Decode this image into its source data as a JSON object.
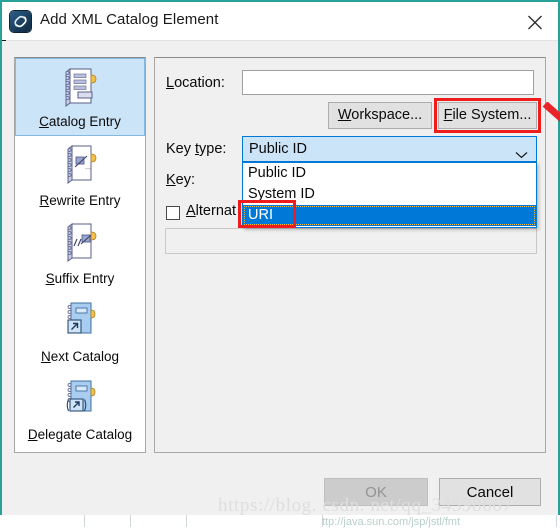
{
  "window": {
    "title": "Add XML Catalog Element",
    "icon": "xml-catalog-icon",
    "close_icon": "close-icon",
    "frame_color": "#2aa198"
  },
  "sidebar": {
    "items": [
      {
        "label": "Catalog Entry",
        "mnemonic": "C",
        "icon": "catalog-entry-icon",
        "selected": true
      },
      {
        "label": "Rewrite Entry",
        "mnemonic": "R",
        "icon": "rewrite-entry-icon",
        "selected": false
      },
      {
        "label": "Suffix Entry",
        "mnemonic": "S",
        "icon": "suffix-entry-icon",
        "selected": false
      },
      {
        "label": "Next Catalog",
        "mnemonic": "N",
        "icon": "next-catalog-icon",
        "selected": false
      },
      {
        "label": "Delegate Catalog",
        "mnemonic": "D",
        "icon": "delegate-catalog-icon",
        "selected": false
      }
    ]
  },
  "form": {
    "location": {
      "label": "Location:",
      "mnemonic": "L",
      "value": "",
      "placeholder": ""
    },
    "workspace_button": {
      "label": "Workspace...",
      "mnemonic": "W"
    },
    "file_system_button": {
      "label": "File System...",
      "mnemonic": "F",
      "highlighted": true
    },
    "key_type": {
      "label": "Key type:",
      "mnemonic": "t",
      "selected": "Public ID",
      "expanded": true,
      "options": [
        "Public ID",
        "System ID",
        "URI"
      ],
      "highlighted_option": "URI",
      "chevron_icon": "chevron-down-icon"
    },
    "key": {
      "label": "Key:",
      "mnemonic": "K",
      "value": ""
    },
    "alternate": {
      "label": "Alternat",
      "mnemonic": "A",
      "checked": false,
      "value": ""
    }
  },
  "annotations": {
    "arrow_icon": "red-arrow-annotation",
    "arrow_color": "#ee1c1c",
    "box_color": "#ee1c1c"
  },
  "footer": {
    "ok_label": "OK",
    "ok_enabled": false,
    "cancel_label": "Cancel"
  },
  "watermark": {
    "text": "https://blog. csdn. net/qq_34598667",
    "background_text": "ttp://java.sun.com/jsp/jstl/fmt"
  }
}
